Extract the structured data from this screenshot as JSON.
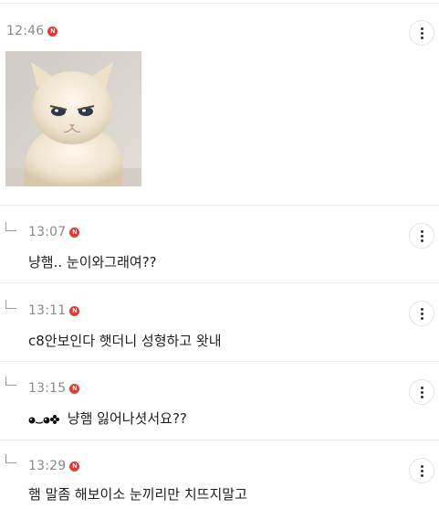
{
  "post": {
    "time": "12:46",
    "badge": "N"
  },
  "replies": [
    {
      "time": "13:07",
      "badge": "N",
      "text": "냥햄.. 눈이와그래여??"
    },
    {
      "time": "13:11",
      "badge": "N",
      "text": "c8안보인다 햇더니 성형하고 왓내"
    },
    {
      "time": "13:15",
      "badge": "N",
      "text": "냥햄 잃어나셧서요??",
      "emoticon": "face-emoticon-icon"
    },
    {
      "time": "13:29",
      "badge": "N",
      "text": "햄 말좀 해보이소 눈끼리만 치뜨지말고"
    }
  ],
  "colors": {
    "badge": "#e53a2f",
    "time": "#8a8a8a",
    "divider": "#ececec"
  },
  "icons": {
    "more": "more-vertical-icon",
    "reply": "reply-arrow-icon",
    "badge": "new-badge-icon"
  }
}
